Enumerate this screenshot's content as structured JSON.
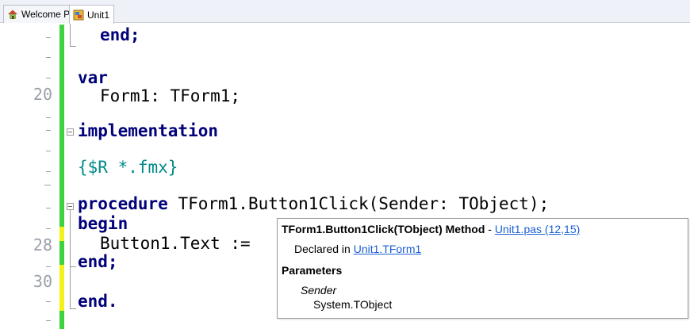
{
  "tabs": [
    {
      "label": "Welcome Page",
      "icon": "home-icon",
      "active": false
    },
    {
      "label": "Unit1",
      "icon": "unit-file-icon",
      "active": true
    }
  ],
  "gutter": {
    "line_numbers": [
      "20",
      "28",
      "30"
    ]
  },
  "code": {
    "line_end_begin": "end;",
    "kw_var": "var",
    "form_decl": "Form1: TForm1;",
    "kw_implementation": "implementation",
    "directive": "{$R *.fmx}",
    "kw_procedure": "procedure",
    "proc_sig": " TForm1.Button1Click(Sender: TObject);",
    "kw_begin": "begin",
    "button_stmt": "Button1.Text :=",
    "kw_end_semi": "end;",
    "kw_end_dot": "end."
  },
  "tooltip": {
    "signature": "TForm1.Button1Click(TObject) Method",
    "separator": " - ",
    "source_link": "Unit1.pas (12,15)",
    "declared_prefix": "Declared in ",
    "declared_link": "Unit1.TForm1",
    "params_heading": "Parameters",
    "param_name": "Sender",
    "param_type": "System.TObject"
  },
  "colors": {
    "keyword": "#00007a",
    "directive": "#008a8a",
    "modified_bar": "#3ed23e",
    "saved_bar": "#f2f21a",
    "link": "#1a5fd4"
  }
}
